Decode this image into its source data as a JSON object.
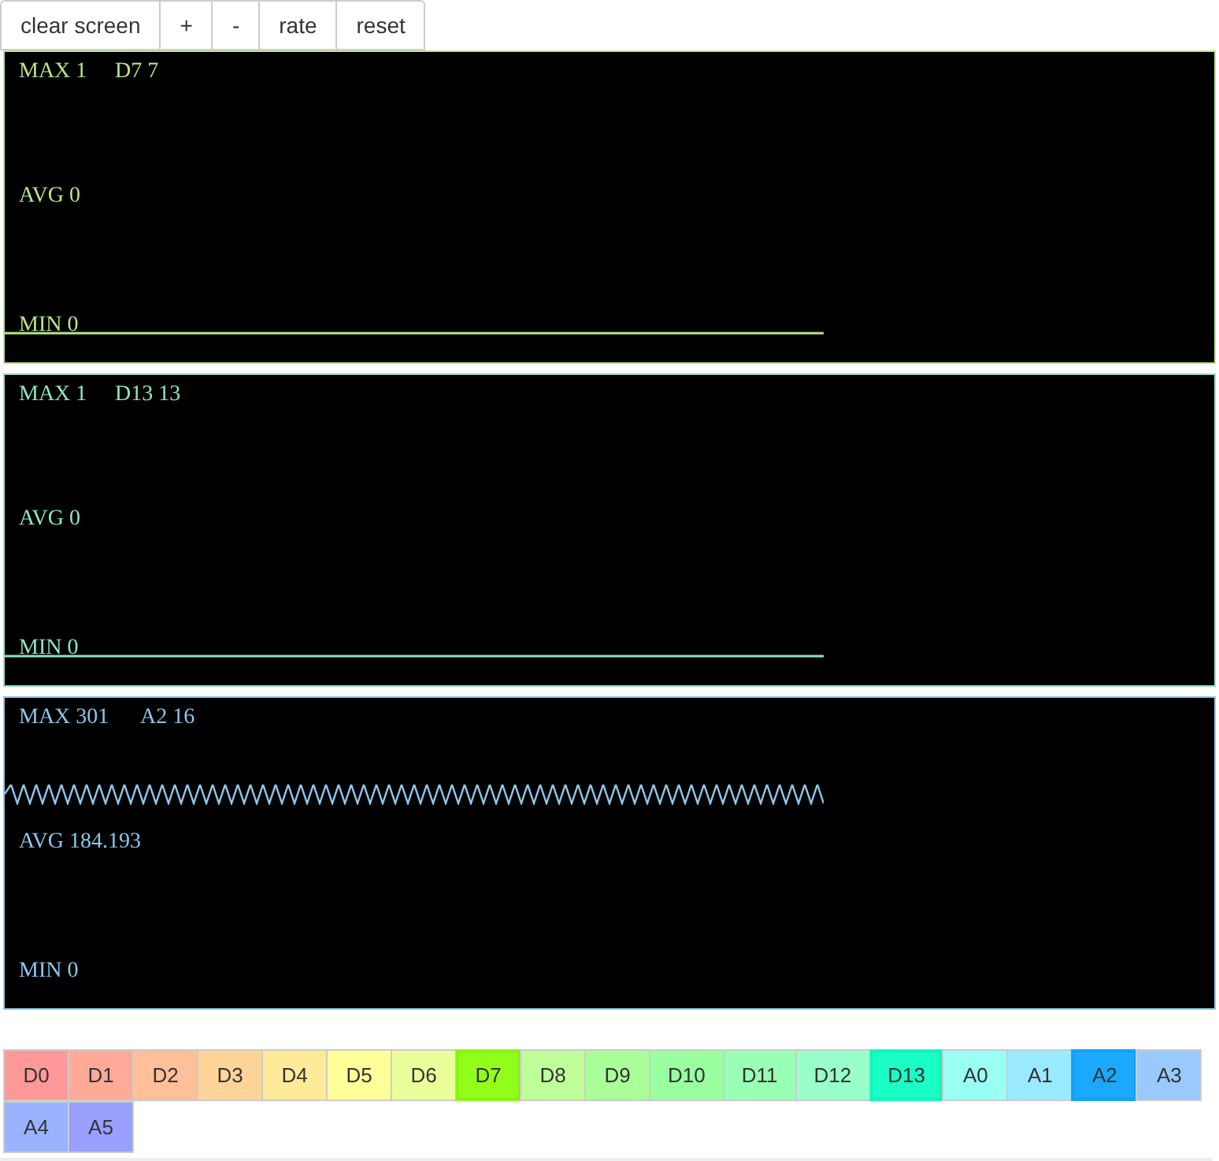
{
  "toolbar": [
    "clear screen",
    "+",
    "-",
    "rate",
    "reset"
  ],
  "scopes": [
    {
      "max": "MAX 1",
      "channel": "D7 7",
      "avg": "AVG 0",
      "min": "MIN 0",
      "color": "#b7e68a",
      "kind": "flat"
    },
    {
      "max": "MAX 1",
      "channel": "D13 13",
      "avg": "AVG 0",
      "min": "MIN 0",
      "color": "#8fe3c8",
      "kind": "flat"
    },
    {
      "max": "MAX 301",
      "channel": "A2 16",
      "avg": "AVG 184.193",
      "min": "MIN 0",
      "color": "#8cc7ea",
      "kind": "wave"
    }
  ],
  "pins": [
    {
      "label": "D0",
      "color": "#ff9999",
      "selected": false
    },
    {
      "label": "D1",
      "color": "#ffaa99",
      "selected": false
    },
    {
      "label": "D2",
      "color": "#ffbf99",
      "selected": false
    },
    {
      "label": "D3",
      "color": "#ffd499",
      "selected": false
    },
    {
      "label": "D4",
      "color": "#ffea99",
      "selected": false
    },
    {
      "label": "D5",
      "color": "#ffff99",
      "selected": false
    },
    {
      "label": "D6",
      "color": "#eaff99",
      "selected": false
    },
    {
      "label": "D7",
      "color": "#91ff1a",
      "selected": true
    },
    {
      "label": "D8",
      "color": "#bfff99",
      "selected": false
    },
    {
      "label": "D9",
      "color": "#aaff99",
      "selected": false
    },
    {
      "label": "D10",
      "color": "#99ff9f",
      "selected": false
    },
    {
      "label": "D11",
      "color": "#99ffb4",
      "selected": false
    },
    {
      "label": "D12",
      "color": "#99ffca",
      "selected": false
    },
    {
      "label": "D13",
      "color": "#1affc6",
      "selected": true
    },
    {
      "label": "A0",
      "color": "#99fff5",
      "selected": false
    },
    {
      "label": "A1",
      "color": "#99eaff",
      "selected": false
    },
    {
      "label": "A2",
      "color": "#1aa9ff",
      "selected": true
    },
    {
      "label": "A3",
      "color": "#99c9ff",
      "selected": false
    },
    {
      "label": "A4",
      "color": "#99b3ff",
      "selected": false
    },
    {
      "label": "A5",
      "color": "#999fff",
      "selected": false
    }
  ]
}
